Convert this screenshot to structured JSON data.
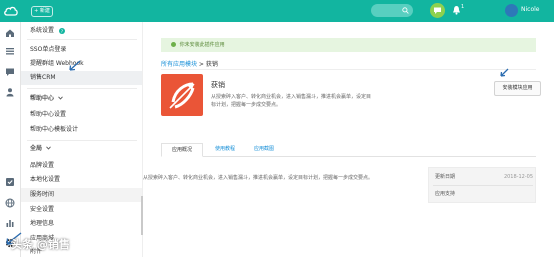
{
  "colors": {
    "brand": "#12b5a0",
    "link": "#1890d8",
    "notice_bg": "#e6f5e0",
    "app_icon": "#ea5537",
    "chat": "#8ed14f"
  },
  "topbar": {
    "logo_icon": "cloud-icon",
    "new_label": "+ 新建",
    "search_icon": "search-icon",
    "chat_icon": "chat-icon",
    "bell_icon": "bell-icon",
    "notification_count": "1",
    "username": "Nicole"
  },
  "leftnav": {
    "icons": [
      "home-icon",
      "list-icon",
      "message-icon",
      "user-icon",
      "check-icon",
      "globe-icon",
      "bar-chart-icon",
      "settings-icon"
    ]
  },
  "sidebar": {
    "section_title": "系统设置",
    "help_icon": "question-icon",
    "items": [
      {
        "label": "SSO单点登录"
      },
      {
        "label": "提醒群组 Webhook"
      },
      {
        "label": "销售CRM"
      },
      {
        "label": "帮助中心"
      },
      {
        "label": "帮助中心设置"
      },
      {
        "label": "帮助中心模板设计"
      },
      {
        "label": "全局"
      },
      {
        "label": "品牌设置"
      },
      {
        "label": "本地化设置"
      },
      {
        "label": "服务时间"
      },
      {
        "label": "安全设置"
      },
      {
        "label": "地理信息"
      },
      {
        "label": "应用商城"
      },
      {
        "label": "附件"
      }
    ]
  },
  "main": {
    "notice": "你未安装此插件应用",
    "breadcrumb": {
      "link": "所有应用模块",
      "sep": " > ",
      "current": "获销"
    },
    "app": {
      "name": "获销",
      "description": "从授索碎入客户、转化商业机会，进入销售漏斗，推进机会赢单，设定目标计划，把握每一步成交要点。",
      "install_label": "安装模块应用"
    },
    "tabs": [
      {
        "label": "应用概况"
      },
      {
        "label": "使用教程"
      },
      {
        "label": "应用截图"
      }
    ],
    "detail_text": "从授索碎入客户、转化商业机会，进入销售漏斗，推进机会赢单，设定目标计划，把握每一步成交要点。",
    "panel": {
      "update_label": "更新日期",
      "update_value": "2018-12-05",
      "support_label": "应用支持"
    }
  },
  "watermark": "头条 @销售"
}
